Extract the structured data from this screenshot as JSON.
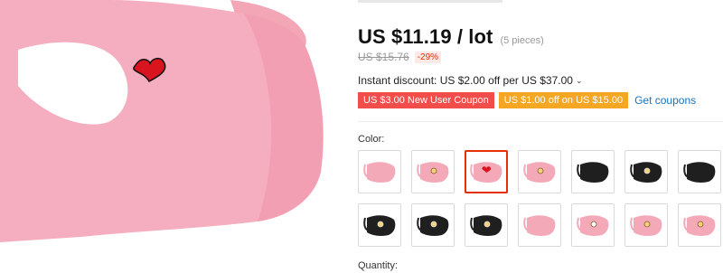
{
  "product": {
    "image_alt_icon": "pink-face-mask-with-heart",
    "price": "US $11.19 / lot",
    "pieces": "(5 pieces)",
    "original_price": "US $15.76",
    "discount": "-29%",
    "instant_discount": "Instant discount: US $2.00 off per US $37.00",
    "coupons": [
      {
        "label": "US $3.00 New User Coupon",
        "style": "red",
        "color": "#f24d4b"
      },
      {
        "label": "US $1.00 off on US $15.00",
        "style": "orange",
        "color": "#f5a623"
      }
    ],
    "get_coupons": "Get coupons"
  },
  "color": {
    "label": "Color:",
    "selected_index": 2,
    "options": [
      {
        "mask": "#f4a9b8",
        "decal": "none"
      },
      {
        "mask": "#f4a9b8",
        "decal": "character"
      },
      {
        "mask": "#f4a9b8",
        "decal": "heart"
      },
      {
        "mask": "#f4a9b8",
        "decal": "character"
      },
      {
        "mask": "#1f1f1f",
        "decal": "none"
      },
      {
        "mask": "#1f1f1f",
        "decal": "character"
      },
      {
        "mask": "#1f1f1f",
        "decal": "none"
      },
      {
        "mask": "#1f1f1f",
        "decal": "character"
      },
      {
        "mask": "#1f1f1f",
        "decal": "character"
      },
      {
        "mask": "#1f1f1f",
        "decal": "character"
      },
      {
        "mask": "#f4a9b8",
        "decal": "none"
      },
      {
        "mask": "#f4a9b8",
        "decal": "flower"
      },
      {
        "mask": "#f4a9b8",
        "decal": "character"
      },
      {
        "mask": "#f4a9b8",
        "decal": "character"
      }
    ]
  },
  "quantity": {
    "label": "Quantity:"
  },
  "colors": {
    "accent_red": "#e62e04",
    "link_blue": "#1a73b8",
    "mask_pink": "#f4a9b8",
    "mask_black": "#1f1f1f"
  }
}
